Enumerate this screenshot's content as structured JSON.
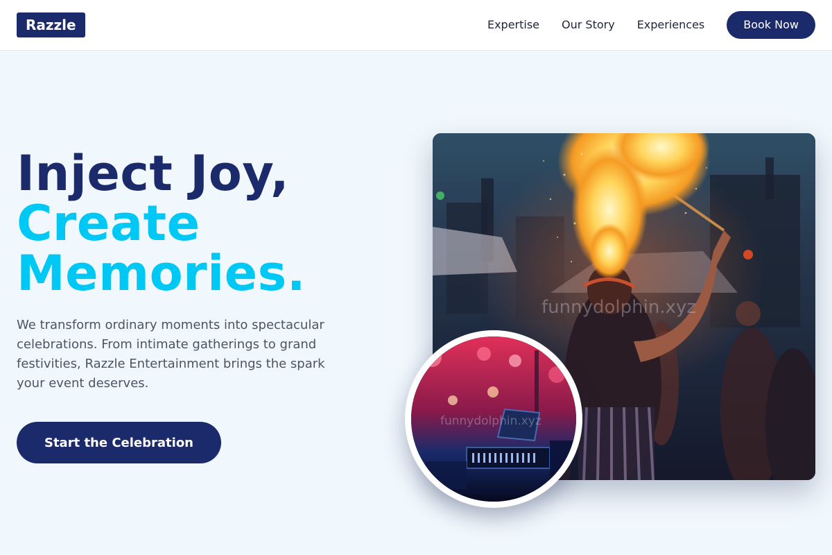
{
  "header": {
    "logo": "Razzle",
    "nav": [
      {
        "label": "Expertise"
      },
      {
        "label": "Our Story"
      },
      {
        "label": "Experiences"
      }
    ],
    "book_label": "Book Now"
  },
  "hero": {
    "headline_line1": "Inject Joy,",
    "headline_line2": "Create",
    "headline_line3": "Memories.",
    "description": "We transform ordinary moments into spectacular celebrations. From intimate gatherings to grand festivities, Razzle Entertainment brings the spark your event deserves.",
    "cta_label": "Start the Celebration"
  },
  "images": {
    "main_watermark": "funnydolphin.xyz",
    "circle_watermark": "funnydolphin.xyz"
  },
  "colors": {
    "brand_navy": "#1b2a6b",
    "accent_cyan": "#00c8f5",
    "page_bg": "#f0f7fd"
  }
}
